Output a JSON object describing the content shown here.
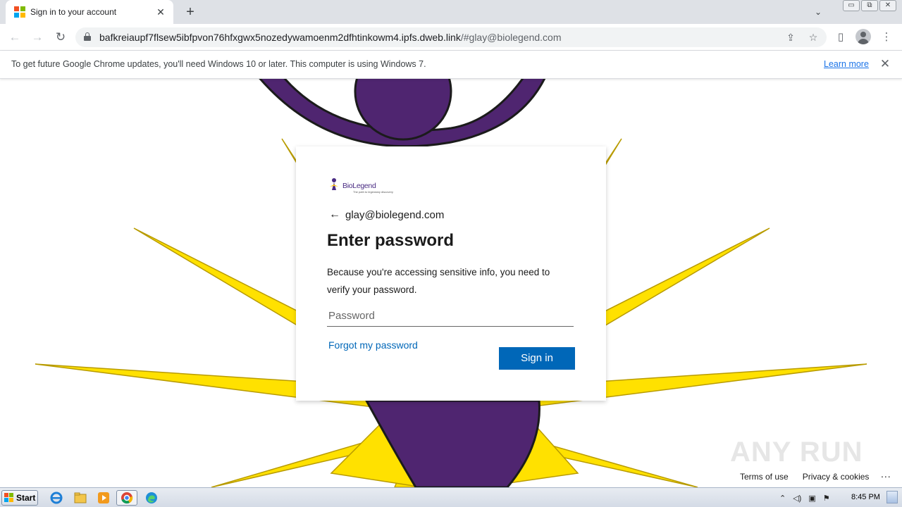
{
  "browser": {
    "tab": {
      "title": "Sign in to your account",
      "close_glyph": "✕",
      "favicon_colors": [
        "#f25022",
        "#7fba00",
        "#00a4ef",
        "#ffb900"
      ]
    },
    "new_tab_glyph": "+",
    "tab_search_glyph": "⌄",
    "window_buttons": [
      "▭",
      "⧉",
      "✕"
    ],
    "nav": {
      "back": "←",
      "forward": "→",
      "reload": "↻"
    },
    "url": {
      "host": "bafkreiaupf7flsew5ibfpvon76hfxgwx5nozedywamoenm2dfhtinkowm4.ipfs.dweb.link",
      "rest": "/#glay@biolegend.com"
    },
    "toolbar_icons": {
      "share": "⇪",
      "bookmark": "☆",
      "side_panel": "▯",
      "menu": "⋮"
    }
  },
  "infobar": {
    "message": "To get future Google Chrome updates, you'll need Windows 10 or later. This computer is using Windows 7.",
    "learn_more": "Learn more",
    "close_glyph": "✕"
  },
  "signin": {
    "logo": {
      "name": "BioLegend",
      "tagline": "The path to legendary discovery",
      "color": "#4a2c83"
    },
    "back_glyph": "←",
    "identity": "glay@biolegend.com",
    "heading": "Enter password",
    "description": "Because you're accessing sensitive info, you need to verify your password.",
    "password_placeholder": "Password",
    "forgot_link": "Forgot my password",
    "submit_label": "Sign in",
    "accent": "#0067b8"
  },
  "footer": {
    "terms": "Terms of use",
    "privacy": "Privacy & cookies",
    "more": "..."
  },
  "watermark": {
    "text": "ANY RUN"
  },
  "background": {
    "purple": "#4f2570",
    "yellow": "#ffe100"
  },
  "taskbar": {
    "start_label": "Start",
    "clock": "8:45 PM",
    "tray_glyphs": {
      "expand": "⌃",
      "speaker": "◁)",
      "network": "▣",
      "flag": "⚑"
    }
  }
}
